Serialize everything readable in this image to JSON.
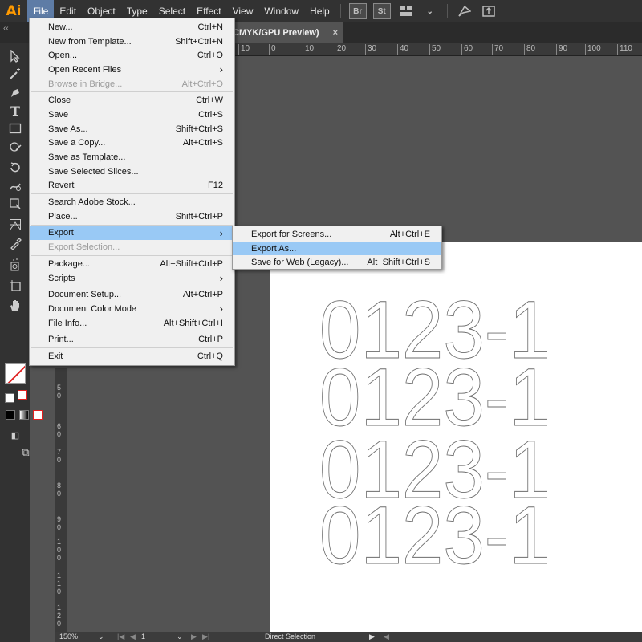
{
  "menubar": {
    "logo": "Ai",
    "items": [
      "File",
      "Edit",
      "Object",
      "Type",
      "Select",
      "Effect",
      "View",
      "Window",
      "Help"
    ],
    "active_index": 0,
    "icons": [
      "bridge-icon",
      "stock-icon",
      "workspace-icon",
      "chevron-down-icon",
      "gpu-icon",
      "publish-icon"
    ],
    "bridge_label": "Br",
    "stock_label": "St"
  },
  "document": {
    "tab_title": "CMYK/GPU Preview)",
    "tab_close": "×",
    "collapse": "‹‹"
  },
  "ruler": {
    "top": [
      "10",
      "0",
      "10",
      "20",
      "30",
      "40",
      "50",
      "60",
      "70",
      "80",
      "90",
      "100",
      "110"
    ],
    "left": [
      "5\n0",
      "6\n0",
      "7\n0",
      "8\n0",
      "9\n0",
      "1\n0\n0",
      "1\n1\n0",
      "1\n2\n0"
    ]
  },
  "artwork": {
    "lines": [
      "0123-1",
      "0123-1",
      "0123-1",
      "0123-1"
    ]
  },
  "file_menu": {
    "groups": [
      [
        {
          "label": "New...",
          "shortcut": "Ctrl+N"
        },
        {
          "label": "New from Template...",
          "shortcut": "Shift+Ctrl+N"
        },
        {
          "label": "Open...",
          "shortcut": "Ctrl+O"
        },
        {
          "label": "Open Recent Files",
          "submenu": true
        },
        {
          "label": "Browse in Bridge...",
          "shortcut": "Alt+Ctrl+O",
          "disabled": true
        }
      ],
      [
        {
          "label": "Close",
          "shortcut": "Ctrl+W"
        },
        {
          "label": "Save",
          "shortcut": "Ctrl+S"
        },
        {
          "label": "Save As...",
          "shortcut": "Shift+Ctrl+S"
        },
        {
          "label": "Save a Copy...",
          "shortcut": "Alt+Ctrl+S"
        },
        {
          "label": "Save as Template..."
        },
        {
          "label": "Save Selected Slices..."
        },
        {
          "label": "Revert",
          "shortcut": "F12"
        }
      ],
      [
        {
          "label": "Search Adobe Stock..."
        },
        {
          "label": "Place...",
          "shortcut": "Shift+Ctrl+P"
        }
      ],
      [
        {
          "label": "Export",
          "submenu": true,
          "highlighted": true
        },
        {
          "label": "Export Selection...",
          "disabled": true
        }
      ],
      [
        {
          "label": "Package...",
          "shortcut": "Alt+Shift+Ctrl+P"
        },
        {
          "label": "Scripts",
          "submenu": true
        }
      ],
      [
        {
          "label": "Document Setup...",
          "shortcut": "Alt+Ctrl+P"
        },
        {
          "label": "Document Color Mode",
          "submenu": true
        },
        {
          "label": "File Info...",
          "shortcut": "Alt+Shift+Ctrl+I"
        }
      ],
      [
        {
          "label": "Print...",
          "shortcut": "Ctrl+P"
        }
      ],
      [
        {
          "label": "Exit",
          "shortcut": "Ctrl+Q"
        }
      ]
    ]
  },
  "export_submenu": [
    {
      "label": "Export for Screens...",
      "shortcut": "Alt+Ctrl+E"
    },
    {
      "label": "Export As...",
      "highlighted": true
    },
    {
      "label": "Save for Web (Legacy)...",
      "shortcut": "Alt+Shift+Ctrl+S"
    }
  ],
  "statusbar": {
    "zoom": "150%",
    "artboard_number": "1",
    "tool": "Direct Selection"
  },
  "colors": {
    "menu_highlight": "#99c9f5",
    "active_menu": "#5e7ca6",
    "logo": "#ff9a00"
  }
}
